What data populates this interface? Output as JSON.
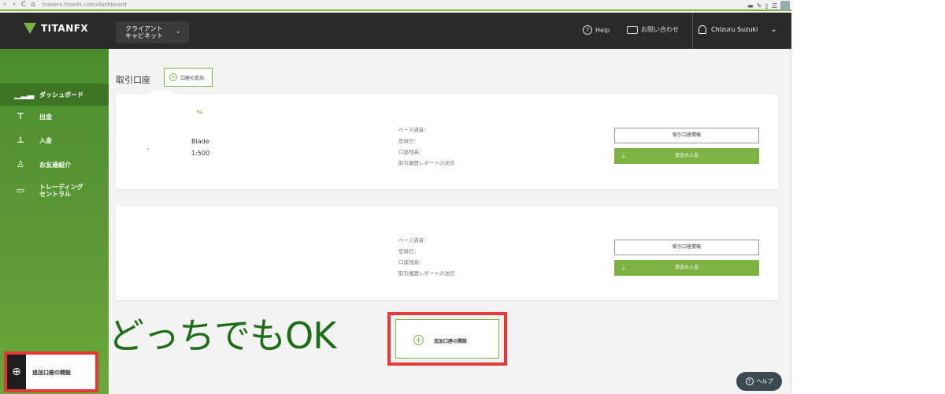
{
  "browser": {
    "url": "traders.titanfx.com/dashboard",
    "back": "‹",
    "forward": "›",
    "reload": "C",
    "home": "⌂"
  },
  "header": {
    "logo_text": "TITANFX",
    "client_selector_line1": "クライアント",
    "client_selector_line2": "キャビネット",
    "help_label": "Help",
    "contact_label": "お問い合わせ",
    "user_name": "Chizuru Suzuki"
  },
  "sidebar": {
    "items": [
      {
        "label": "ダッシュボード",
        "icon": "bar-chart-icon"
      },
      {
        "label": "出金",
        "icon": "withdraw-icon"
      },
      {
        "label": "入金",
        "icon": "deposit-icon"
      },
      {
        "label": "お友達紹介",
        "icon": "user-icon"
      },
      {
        "label_line1": "トレーディング",
        "label_line2": "セントラル",
        "icon": "monitor-icon"
      }
    ],
    "add_account_label": "追加口座の開設"
  },
  "main": {
    "title": "取引口座",
    "open_account_label": "口座の追加",
    "accounts": [
      {
        "type": "Blade",
        "leverage": "1:500",
        "info": [
          "ベース通貨：",
          "登録日：",
          "口座残高：",
          "取引履歴レポートの送信"
        ],
        "history_button": "取引口座情報",
        "deposit_button": "資金の入金"
      },
      {
        "info": [
          "ベース通貨：",
          "登録日：",
          "口座残高：",
          "取引履歴レポートの送信"
        ],
        "history_button": "取引口座情報",
        "deposit_button": "資金の入金"
      }
    ],
    "annotation": "どっちでもOK",
    "add_card_label": "追加口座の開設"
  },
  "help_fab": "ヘルプ",
  "colors": {
    "brand_green": "#7cb342",
    "header_dark": "#2a2a2a",
    "highlight_red": "#e53935",
    "annotation_green": "#1f6e1a"
  }
}
